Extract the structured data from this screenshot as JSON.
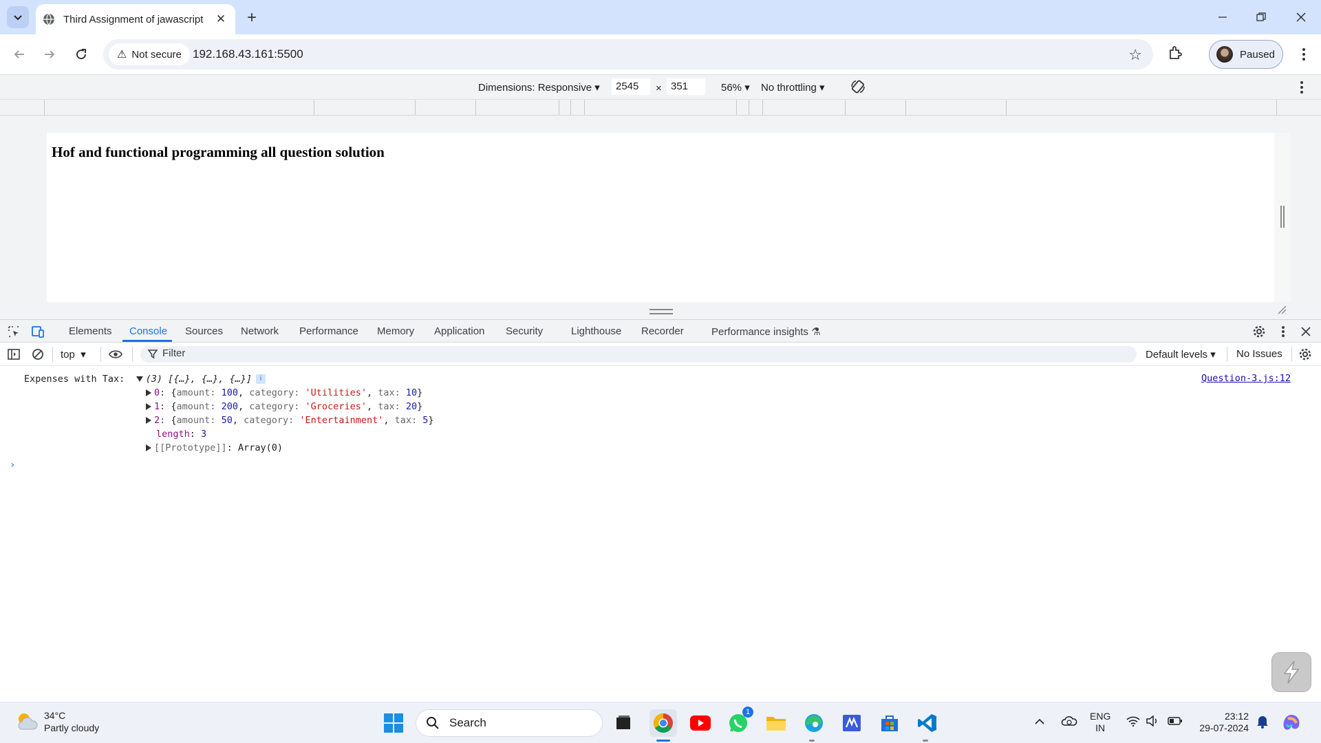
{
  "browser": {
    "tab": {
      "title": "Third Assignment of jawascript",
      "close_symbol": "✕"
    },
    "new_tab_symbol": "+",
    "security_label": "Not secure",
    "url": "192.168.43.161:5500",
    "profile_label": "Paused"
  },
  "device_toolbar": {
    "dimensions_label": "Dimensions: Responsive",
    "width_value": "2545",
    "times_symbol": "×",
    "height_value": "351",
    "zoom_label": "56%",
    "throttling_label": "No throttling"
  },
  "page": {
    "heading": "Hof and functional programming all question solution"
  },
  "devtools": {
    "tabs": [
      "Elements",
      "Console",
      "Sources",
      "Network",
      "Performance",
      "Memory",
      "Application",
      "Security",
      "Lighthouse",
      "Recorder",
      "Performance insights"
    ],
    "active_tab": "Console",
    "context_label": "top",
    "filter_placeholder": "Filter",
    "levels_label": "Default levels",
    "issues_label": "No Issues"
  },
  "console": {
    "log_label": "Expenses with Tax:",
    "array_summary": "(3) [{…}, {…}, {…}]",
    "source_link": "Question-3.js:12",
    "entries": [
      {
        "index": "0",
        "amount": "100",
        "category": "'Utilities'",
        "tax": "10"
      },
      {
        "index": "1",
        "amount": "200",
        "category": "'Groceries'",
        "tax": "20"
      },
      {
        "index": "2",
        "amount": "50",
        "category": "'Entertainment'",
        "tax": "5"
      }
    ],
    "length_key": "length",
    "length_value": "3",
    "prototype_key": "[[Prototype]]",
    "prototype_value": "Array(0)"
  },
  "taskbar": {
    "weather_temp": "34°C",
    "weather_desc": "Partly cloudy",
    "search_label": "Search",
    "whatsapp_badge": "1",
    "lang_line1": "ENG",
    "lang_line2": "IN",
    "time": "23:12",
    "date": "29-07-2024"
  },
  "colors": {
    "accent": "#1a73e8",
    "tabstrip": "#d3e3fd",
    "string_red": "#c41a16",
    "number_blue": "#1a1aa6"
  }
}
